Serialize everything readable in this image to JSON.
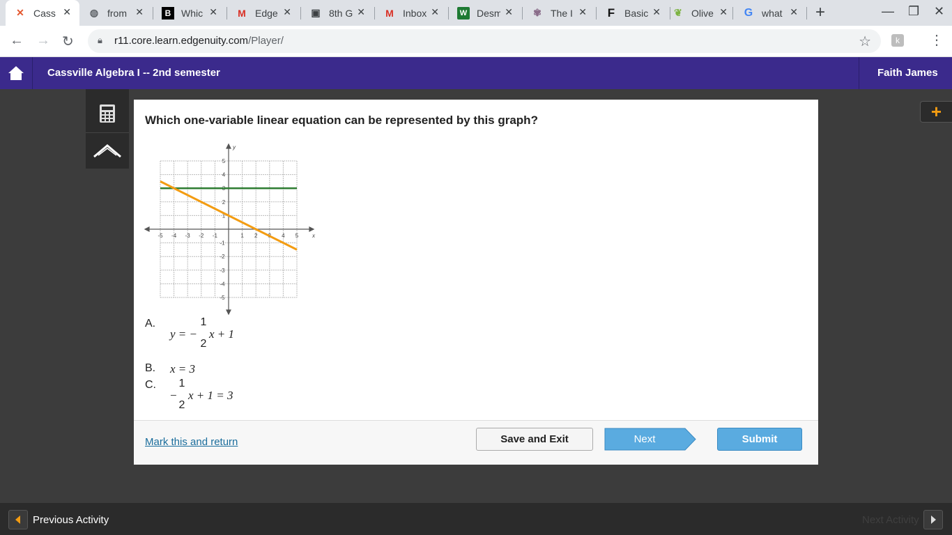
{
  "browser": {
    "tabs": [
      {
        "label": "Cass",
        "icon": "edgenuity-x-icon",
        "active": true
      },
      {
        "label": "from",
        "icon": "globe-icon"
      },
      {
        "label": "Whic",
        "icon": "brainly-icon"
      },
      {
        "label": "Edge",
        "icon": "gmail-icon"
      },
      {
        "label": "8th G",
        "icon": "classroom-icon"
      },
      {
        "label": "Inbox",
        "icon": "gmail-icon"
      },
      {
        "label": "Desm",
        "icon": "desmos-icon"
      },
      {
        "label": "The I",
        "icon": "site-icon"
      },
      {
        "label": "Basic",
        "icon": "f-icon"
      },
      {
        "label": "Olive",
        "icon": "leaf-icon"
      },
      {
        "label": "what",
        "icon": "google-icon"
      }
    ],
    "url_host": "r11.core.learn.edgenuity.com",
    "url_path": "/Player/"
  },
  "header": {
    "course_title": "Cassville Algebra I -- 2nd semester",
    "user_name": "Faith James"
  },
  "question": {
    "prompt": "Which one-variable linear equation can be represented by this graph?",
    "graph": {
      "x_ticks": [
        "-5",
        "-4",
        "-3",
        "-2",
        "-1",
        "1",
        "2",
        "3",
        "4",
        "5"
      ],
      "y_ticks": [
        "5",
        "4",
        "3",
        "2",
        "1",
        "-1",
        "-2",
        "-3",
        "-4",
        "-5"
      ],
      "x_label": "x",
      "y_label": "y",
      "lines": [
        {
          "equation": "y = 3",
          "color": "#2e7d32"
        },
        {
          "equation": "y = -1/2 x + 1",
          "color": "#f39c12"
        }
      ]
    },
    "options": [
      {
        "letter": "A.",
        "lead": "y = −",
        "num": "1",
        "den": "2",
        "tail": "x + 1"
      },
      {
        "letter": "B.",
        "text": "x = 3"
      },
      {
        "letter": "C.",
        "lead": "−",
        "num": "1",
        "den": "2",
        "tail": "x + 1 = 3"
      }
    ]
  },
  "footer": {
    "mark_link": "Mark this and return",
    "save_label": "Save and Exit",
    "next_label": "Next",
    "submit_label": "Submit"
  },
  "bottom": {
    "prev_label": "Previous Activity",
    "next_label": "Next Activity"
  },
  "colors": {
    "header_bg": "#3b2a8c",
    "next_button": "#5aabe0",
    "orange_line": "#f39c12",
    "green_line": "#2e7d32"
  }
}
